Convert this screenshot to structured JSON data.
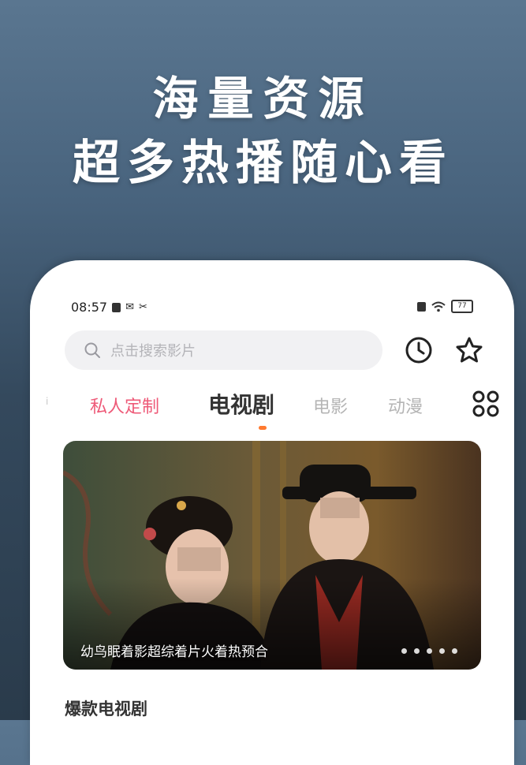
{
  "promo": {
    "line1": "海量资源",
    "line2": "超多热播随心看"
  },
  "status_bar": {
    "time": "08:57",
    "battery": "77"
  },
  "search": {
    "placeholder": "点击搜索影片"
  },
  "tabs": {
    "prev": "i",
    "items": [
      "私人定制",
      "电视剧",
      "电影",
      "动漫"
    ],
    "active_index": 1
  },
  "banner": {
    "caption": "幼鸟眠着影超综着片火着热预合",
    "dot_count": 5,
    "active_dot": 0
  },
  "section": {
    "title": "爆款电视剧"
  },
  "colors": {
    "accent_pink": "#ee5a78",
    "indicator_orange": "#ff7a30",
    "background_top": "#5a7690",
    "background_bottom": "#2a3b4b"
  },
  "icons": [
    "search-icon",
    "history-clock-icon",
    "star-icon",
    "grid-menu-icon"
  ]
}
